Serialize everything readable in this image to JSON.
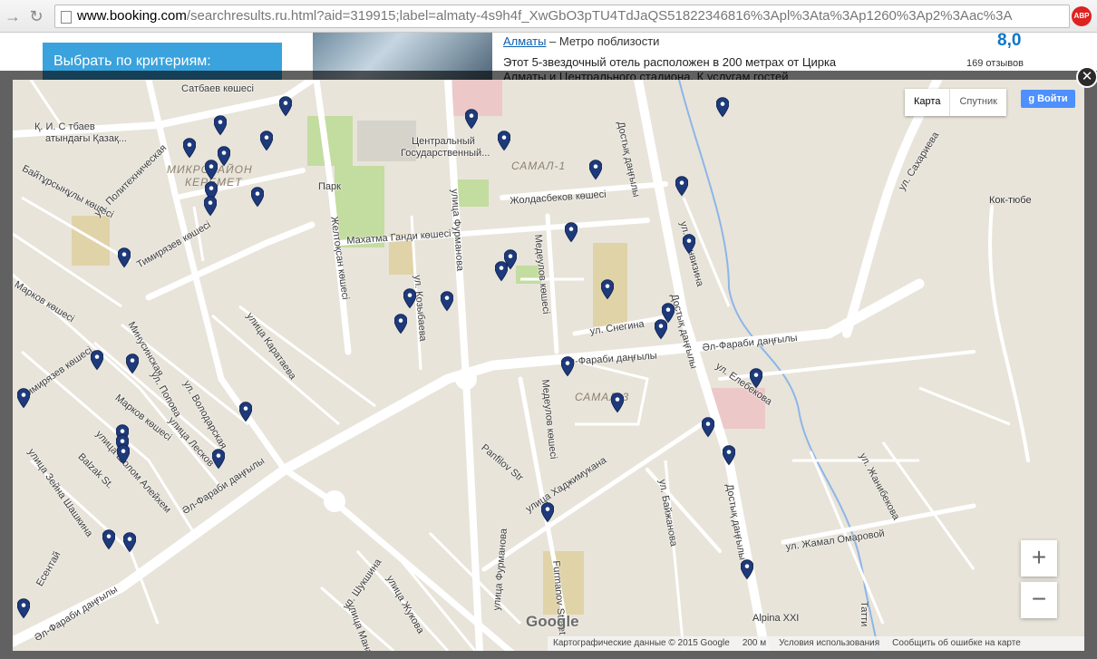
{
  "browser": {
    "url_host": "www.booking.com",
    "url_path": "/searchresults.ru.html?aid=319915;label=almaty-4s9h4f_XwGbO3pTU4TdJaQS51822346816%3Apl%3Ata%3Ap1260%3Ap2%3Aac%3A",
    "adblock_label": "ABP"
  },
  "page": {
    "filter_title": "Выбрать по критериям:",
    "hotel_city": "Алматы",
    "hotel_city_suffix": " – Метро поблизости",
    "hotel_description": "Этот 5-звездочный отель расположен в 200 метрах от Цирка Алматы и Центрального стадиона. К услугам гостей",
    "hotel_score": "8,0",
    "hotel_reviews": "169 отзывов"
  },
  "map": {
    "type_options": [
      "Карта",
      "Спутник"
    ],
    "signin_label": "Войти",
    "zoom_in": "+",
    "zoom_out": "−",
    "google_logo": "Google",
    "footer": {
      "data_credit": "Картографические данные © 2015 Google",
      "scale": "200 м",
      "terms": "Условия использования",
      "report": "Сообщить об ошибке на карте"
    },
    "streets": [
      "Сатбаев көшесі",
      "Қ. И. С тбаев",
      "атындағы Қазақ...",
      "Байтұрсынұлы көшесі",
      "ул. Политехническая",
      "МИКРОРАЙОН",
      "КЕРЕМЕТ",
      "Тимирязев көшесі",
      "Марков көшесі",
      "Тимирязев көшесі",
      "Минусинская",
      "Марков көшесі",
      "ул. Попова",
      "ул. Володарская",
      "улица Лесков",
      "улица Шолом Алейхем",
      "Balzak St.",
      "улица Зейна Шашкина",
      "Есентай",
      "Әл-Фараби даңғылы",
      "Әл-Фараби даңғылы",
      "улица Каратаева",
      "Центральный",
      "Государственный...",
      "Парк",
      "Желтоқсан көшесі",
      "Махатма Ганди көшесі",
      "ул. Козыбаева",
      "улица Фурманова",
      "Жолдасбеков көшесі",
      "Медеулов көшесі",
      "ул. Снегина",
      "Әл-Фараби даңғылы",
      "Медеулов көшесі",
      "Panfilov Str",
      "улица Хаджимукана",
      "ул. Байжанова",
      "Достық даңғылы",
      "Достық даңғылы",
      "Достық даңғылы",
      "ул. Фонвизина",
      "ул. Елебекова",
      "ул. Жамал Омаровой",
      "Әл-Фараби даңғылы",
      "ул. Сахариева",
      "Кок-тюбе",
      "ул. Жанибекова",
      "ул. Шукшина",
      "улица Жукова",
      "улица Манаева",
      "улица Фурманова",
      "Furmanov Street",
      "Alpina XXI",
      "Татти",
      "Самал-1",
      "Самал-3"
    ],
    "marker_count": 48,
    "colors": {
      "map_bg": "#e8e4da",
      "road": "#ffffff",
      "park": "#c3dca0",
      "marker": "#1e3a7b",
      "river": "#8cb6e8",
      "accent": "#3aa2dc"
    }
  }
}
